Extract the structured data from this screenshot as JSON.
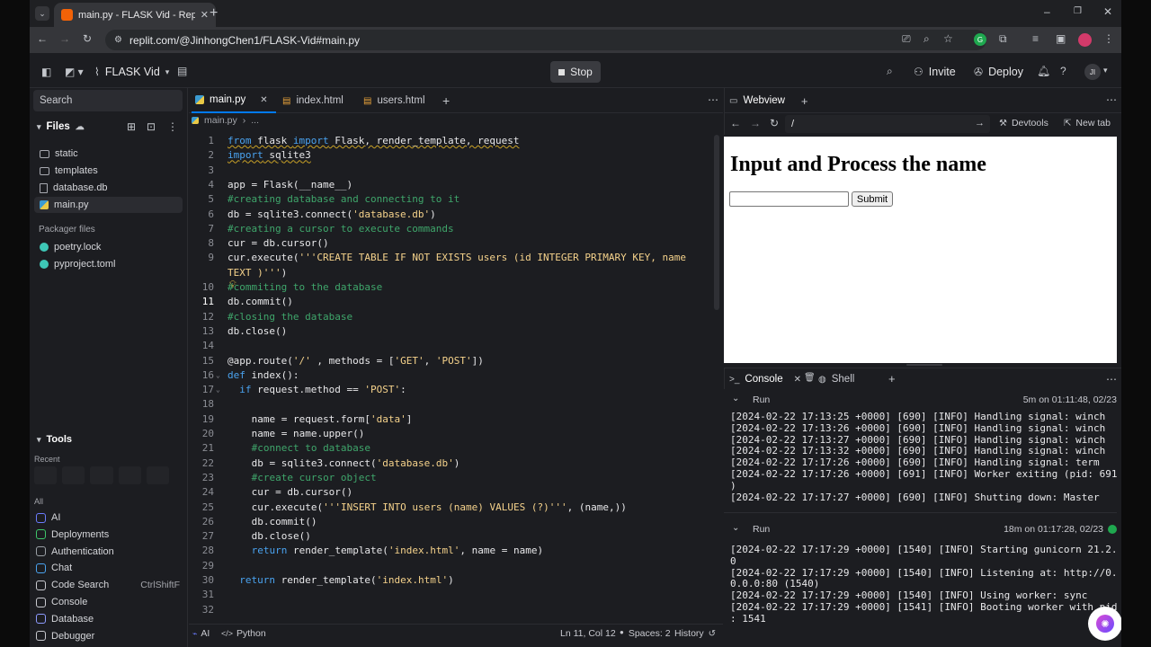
{
  "browser": {
    "tab_title": "main.py - FLASK Vid - Replit",
    "url": "replit.com/@JinhongChen1/FLASK-Vid#main.py"
  },
  "header": {
    "project_name": "FLASK Vid",
    "stop_label": "Stop",
    "invite_label": "Invite",
    "deploy_label": "Deploy",
    "avatar_initials": "JI"
  },
  "sidebar": {
    "search_label": "Search",
    "files_label": "Files",
    "files": [
      {
        "name": "static",
        "type": "folder"
      },
      {
        "name": "templates",
        "type": "folder"
      },
      {
        "name": "database.db",
        "type": "file"
      },
      {
        "name": "main.py",
        "type": "python",
        "selected": true
      }
    ],
    "packager_label": "Packager files",
    "packager_files": [
      "poetry.lock",
      "pyproject.toml"
    ],
    "tools_label": "Tools",
    "recent_label": "Recent",
    "all_label": "All",
    "tools": [
      {
        "name": "AI",
        "icon": "ai-icon",
        "color": "#6b7cff"
      },
      {
        "name": "Deployments",
        "icon": "deployments-icon",
        "color": "#3ec76a"
      },
      {
        "name": "Authentication",
        "icon": "auth-icon",
        "color": "#9aa0a6"
      },
      {
        "name": "Chat",
        "icon": "chat-icon",
        "color": "#4aa3f0"
      },
      {
        "name": "Code Search",
        "icon": "search-icon",
        "color": "#c9cad0",
        "shortcut": "CtrlShiftF"
      },
      {
        "name": "Console",
        "icon": "console-icon",
        "color": "#c9cad0"
      },
      {
        "name": "Database",
        "icon": "database-icon",
        "color": "#8e9bff"
      },
      {
        "name": "Debugger",
        "icon": "debugger-icon",
        "color": "#c9cad0"
      }
    ]
  },
  "editor": {
    "tabs": [
      "main.py",
      "index.html",
      "users.html"
    ],
    "breadcrumb": [
      "main.py",
      "..."
    ],
    "cursor_line": 11,
    "lines": [
      {
        "n": 1,
        "ind": 0,
        "parts": [
          [
            "k",
            "from"
          ],
          [
            "o",
            " flask "
          ],
          [
            "k",
            "import"
          ],
          [
            "o",
            " Flask, render_template, request"
          ]
        ]
      },
      {
        "n": 2,
        "ind": 0,
        "parts": [
          [
            "k",
            "import"
          ],
          [
            "o",
            " sqlite3"
          ]
        ]
      },
      {
        "n": 3,
        "ind": 0,
        "parts": []
      },
      {
        "n": 4,
        "ind": 0,
        "parts": [
          [
            "o",
            "app = Flask(__name__)"
          ]
        ]
      },
      {
        "n": 5,
        "ind": 0,
        "parts": [
          [
            "c",
            "#creating database and connecting to it"
          ]
        ]
      },
      {
        "n": 6,
        "ind": 0,
        "parts": [
          [
            "o",
            "db = sqlite3.connect("
          ],
          [
            "s",
            "'database.db'"
          ],
          [
            "o",
            ")"
          ]
        ]
      },
      {
        "n": 7,
        "ind": 0,
        "parts": [
          [
            "c",
            "#creating a cursor to execute commands"
          ]
        ]
      },
      {
        "n": 8,
        "ind": 0,
        "parts": [
          [
            "o",
            "cur = db.cursor()"
          ]
        ]
      },
      {
        "n": 9,
        "ind": 0,
        "parts": [
          [
            "o",
            "cur.execute("
          ],
          [
            "s",
            "'''CREATE TABLE IF NOT EXISTS users (id INTEGER PRIMARY KEY, name"
          ]
        ]
      },
      {
        "n": "",
        "ind": 0,
        "parts": [
          [
            "s",
            "TEXT )'''"
          ],
          [
            "o",
            ")"
          ]
        ]
      },
      {
        "n": 10,
        "ind": 0,
        "parts": [
          [
            "c",
            "#commiting to the database"
          ]
        ]
      },
      {
        "n": 11,
        "ind": 0,
        "parts": [
          [
            "o",
            "db.commit()"
          ]
        ]
      },
      {
        "n": 12,
        "ind": 0,
        "parts": [
          [
            "c",
            "#closing the database"
          ]
        ]
      },
      {
        "n": 13,
        "ind": 0,
        "parts": [
          [
            "o",
            "db.close()"
          ]
        ]
      },
      {
        "n": 14,
        "ind": 0,
        "parts": []
      },
      {
        "n": 15,
        "ind": 0,
        "parts": [
          [
            "o",
            "@app.route("
          ],
          [
            "s",
            "'/'"
          ],
          [
            "o",
            " , methods = ["
          ],
          [
            "s",
            "'GET'"
          ],
          [
            "o",
            ", "
          ],
          [
            "s",
            "'POST'"
          ],
          [
            "o",
            "])"
          ]
        ]
      },
      {
        "n": 16,
        "ind": 0,
        "parts": [
          [
            "k",
            "def"
          ],
          [
            "o",
            " index():"
          ]
        ]
      },
      {
        "n": 17,
        "ind": 1,
        "parts": [
          [
            "k",
            "if"
          ],
          [
            "o",
            " request.method == "
          ],
          [
            "s",
            "'POST'"
          ],
          [
            "o",
            ":"
          ]
        ]
      },
      {
        "n": 18,
        "ind": 0,
        "parts": []
      },
      {
        "n": 19,
        "ind": 2,
        "parts": [
          [
            "o",
            "name = request.form["
          ],
          [
            "s",
            "'data'"
          ],
          [
            "o",
            "]"
          ]
        ]
      },
      {
        "n": 20,
        "ind": 2,
        "parts": [
          [
            "o",
            "name = name.upper()"
          ]
        ]
      },
      {
        "n": 21,
        "ind": 2,
        "parts": [
          [
            "c",
            "#connect to database"
          ]
        ]
      },
      {
        "n": 22,
        "ind": 2,
        "parts": [
          [
            "o",
            "db = sqlite3.connect("
          ],
          [
            "s",
            "'database.db'"
          ],
          [
            "o",
            ")"
          ]
        ]
      },
      {
        "n": 23,
        "ind": 2,
        "parts": [
          [
            "c",
            "#create cursor object"
          ]
        ]
      },
      {
        "n": 24,
        "ind": 2,
        "parts": [
          [
            "o",
            "cur = db.cursor()"
          ]
        ]
      },
      {
        "n": 25,
        "ind": 2,
        "parts": [
          [
            "o",
            "cur.execute("
          ],
          [
            "s",
            "'''INSERT INTO users (name) VALUES (?)'''"
          ],
          [
            "o",
            ", (name,))"
          ]
        ]
      },
      {
        "n": 26,
        "ind": 2,
        "parts": [
          [
            "o",
            "db.commit()"
          ]
        ]
      },
      {
        "n": 27,
        "ind": 2,
        "parts": [
          [
            "o",
            "db.close()"
          ]
        ]
      },
      {
        "n": 28,
        "ind": 2,
        "parts": [
          [
            "k",
            "return"
          ],
          [
            "o",
            " render_template("
          ],
          [
            "s",
            "'index.html'"
          ],
          [
            "o",
            ", name = name)"
          ]
        ]
      },
      {
        "n": 29,
        "ind": 0,
        "parts": []
      },
      {
        "n": 30,
        "ind": 1,
        "parts": [
          [
            "k",
            "return"
          ],
          [
            "o",
            " render_template("
          ],
          [
            "s",
            "'index.html'"
          ],
          [
            "o",
            ")"
          ]
        ]
      },
      {
        "n": 31,
        "ind": 0,
        "parts": []
      },
      {
        "n": 32,
        "ind": 0,
        "parts": []
      }
    ],
    "status": {
      "ai": "AI",
      "language": "Python",
      "position": "Ln 11, Col 12",
      "spaces": "Spaces: 2",
      "history": "History"
    }
  },
  "webview": {
    "tab_label": "Webview",
    "path": "/",
    "devtools_label": "Devtools",
    "newtab_label": "New tab",
    "heading": "Input and Process the name",
    "submit_label": "Submit"
  },
  "console": {
    "tab_console": "Console",
    "tab_shell": "Shell",
    "runs": [
      {
        "label": "Run",
        "time": "5m on 01:11:48, 02/23",
        "lines": [
          "[2024-02-22 17:13:25 +0000] [690] [INFO] Handling signal: winch",
          "[2024-02-22 17:13:26 +0000] [690] [INFO] Handling signal: winch",
          "[2024-02-22 17:13:27 +0000] [690] [INFO] Handling signal: winch",
          "[2024-02-22 17:13:32 +0000] [690] [INFO] Handling signal: winch",
          "[2024-02-22 17:17:26 +0000] [690] [INFO] Handling signal: term",
          "[2024-02-22 17:17:26 +0000] [691] [INFO] Worker exiting (pid: 691",
          ")",
          "[2024-02-22 17:17:27 +0000] [690] [INFO] Shutting down: Master"
        ]
      },
      {
        "label": "Run",
        "time": "18m on 01:17:28, 02/23",
        "lines": [
          "[2024-02-22 17:17:29 +0000] [1540] [INFO] Starting gunicorn 21.2.",
          "0",
          "[2024-02-22 17:17:29 +0000] [1540] [INFO] Listening at: http://0.",
          "0.0.0:80 (1540)",
          "[2024-02-22 17:17:29 +0000] [1540] [INFO] Using worker: sync",
          "[2024-02-22 17:17:29 +0000] [1541] [INFO] Booting worker with pid",
          ": 1541"
        ]
      }
    ]
  }
}
